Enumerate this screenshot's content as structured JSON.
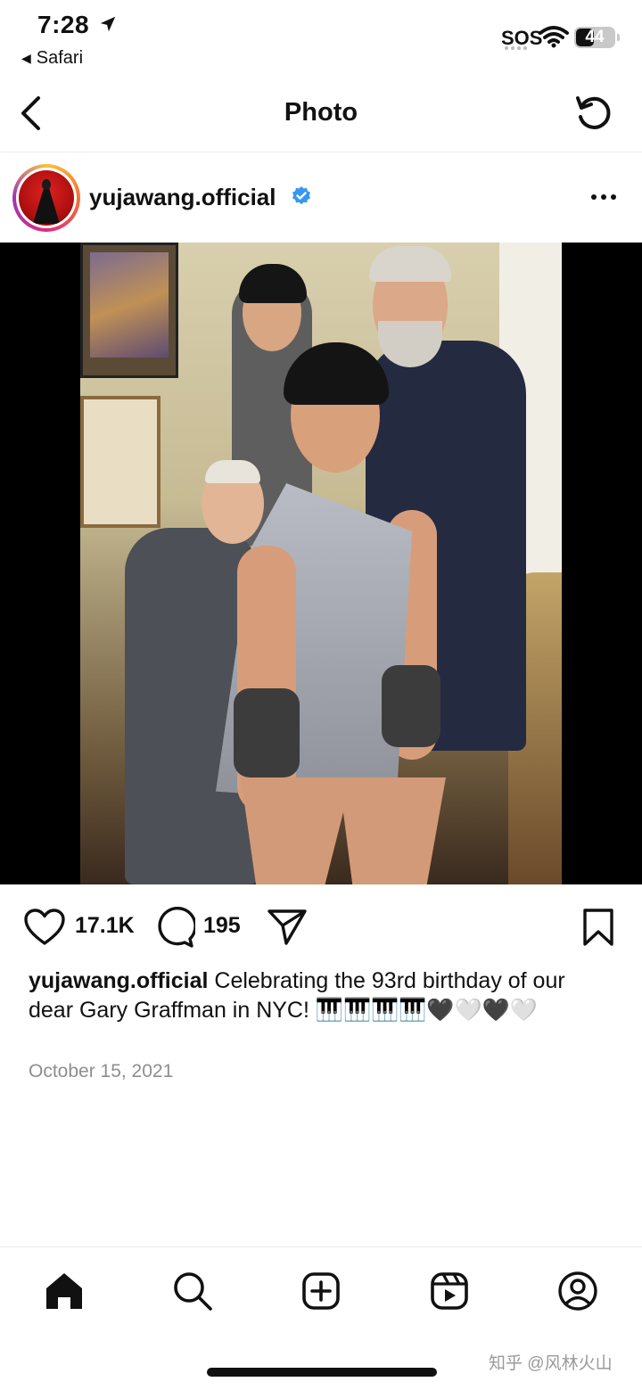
{
  "status_bar": {
    "time": "7:28",
    "back_app": "Safari",
    "signal": "SOS",
    "battery": "44"
  },
  "header": {
    "title": "Photo",
    "back_icon": "chevron-left-icon",
    "refresh_icon": "refresh-icon"
  },
  "post": {
    "username": "yujawang.official",
    "verified": true,
    "likes": "17.1K",
    "comments": "195",
    "caption_username": "yujawang.official",
    "caption_text": "Celebrating the 93rd birthday of our dear Gary Graffman in NYC! 🎹🎹🎹🎹🖤🤍🖤🤍",
    "date": "October 15, 2021"
  },
  "tab_bar": {
    "items": [
      "home-icon",
      "search-icon",
      "create-icon",
      "reels-icon",
      "profile-icon"
    ]
  },
  "watermark": "知乎 @风林火山",
  "colors": {
    "verified_blue": "#3897f0",
    "text": "#111111",
    "muted": "#8e8e8e"
  }
}
